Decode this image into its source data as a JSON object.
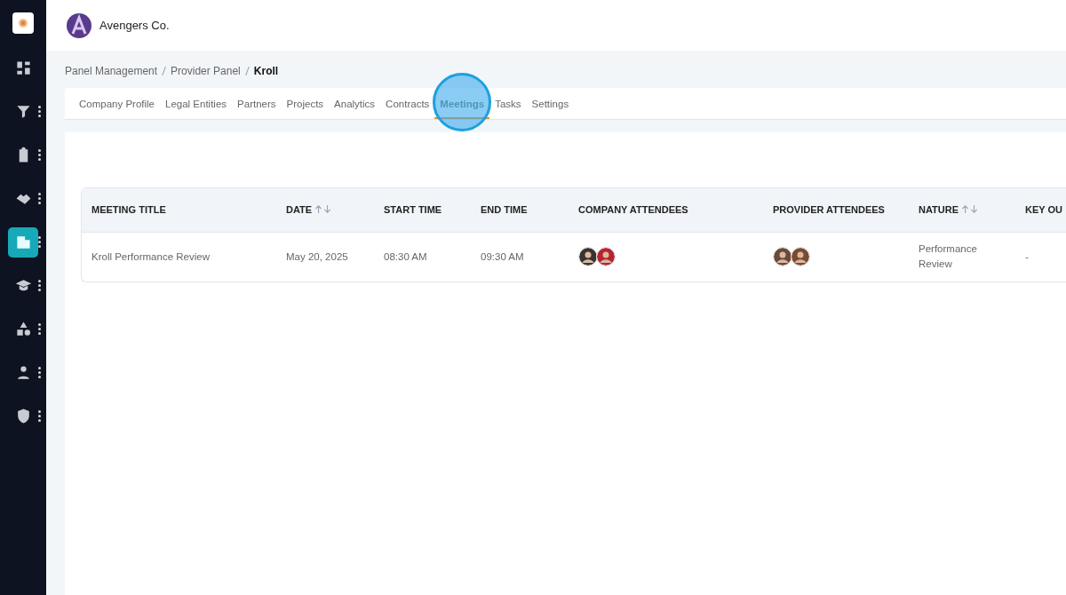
{
  "company": {
    "name": "Avengers Co."
  },
  "sidebar": {
    "items": [
      {
        "menu": false,
        "selected": false
      },
      {
        "menu": true,
        "selected": false
      },
      {
        "menu": true,
        "selected": false
      },
      {
        "menu": true,
        "selected": false
      },
      {
        "menu": true,
        "selected": true
      },
      {
        "menu": true,
        "selected": false
      },
      {
        "menu": true,
        "selected": false
      },
      {
        "menu": true,
        "selected": false
      },
      {
        "menu": true,
        "selected": false
      }
    ]
  },
  "breadcrumb": [
    "Panel Management",
    "Provider Panel",
    "Kroll"
  ],
  "tabs": [
    {
      "label": "Company Profile",
      "selected": false
    },
    {
      "label": "Legal Entities",
      "selected": false
    },
    {
      "label": "Partners",
      "selected": false
    },
    {
      "label": "Projects",
      "selected": false
    },
    {
      "label": "Analytics",
      "selected": false
    },
    {
      "label": "Contracts",
      "selected": false
    },
    {
      "label": "Meetings",
      "selected": true
    },
    {
      "label": "Tasks",
      "selected": false
    },
    {
      "label": "Settings",
      "selected": false
    }
  ],
  "table": {
    "columns": [
      {
        "label": "MEETING TITLE",
        "sortable": false
      },
      {
        "label": "DATE",
        "sortable": true
      },
      {
        "label": "START TIME",
        "sortable": false
      },
      {
        "label": "END TIME",
        "sortable": false
      },
      {
        "label": "COMPANY ATTENDEES",
        "sortable": false
      },
      {
        "label": "PROVIDER ATTENDEES",
        "sortable": false
      },
      {
        "label": "NATURE",
        "sortable": true
      },
      {
        "label": "KEY OU"
      }
    ],
    "rows": [
      {
        "cells": [
          {
            "kind": "text",
            "text": "Kroll Performance Review"
          },
          {
            "kind": "text",
            "text": "May 20, 2025"
          },
          {
            "kind": "text",
            "text": "08:30 AM"
          },
          {
            "kind": "text",
            "text": "09:30 AM"
          },
          {
            "kind": "avatars",
            "avatars": [
              {
                "color": "#3a3330"
              },
              {
                "color": "#b8232f"
              }
            ]
          },
          {
            "kind": "avatars",
            "avatars": [
              {
                "color": "#6b4a38"
              },
              {
                "color": "#7a4a32"
              }
            ]
          },
          {
            "kind": "text",
            "text": "Performance Review"
          },
          {
            "kind": "text",
            "text": "-"
          }
        ]
      }
    ]
  }
}
